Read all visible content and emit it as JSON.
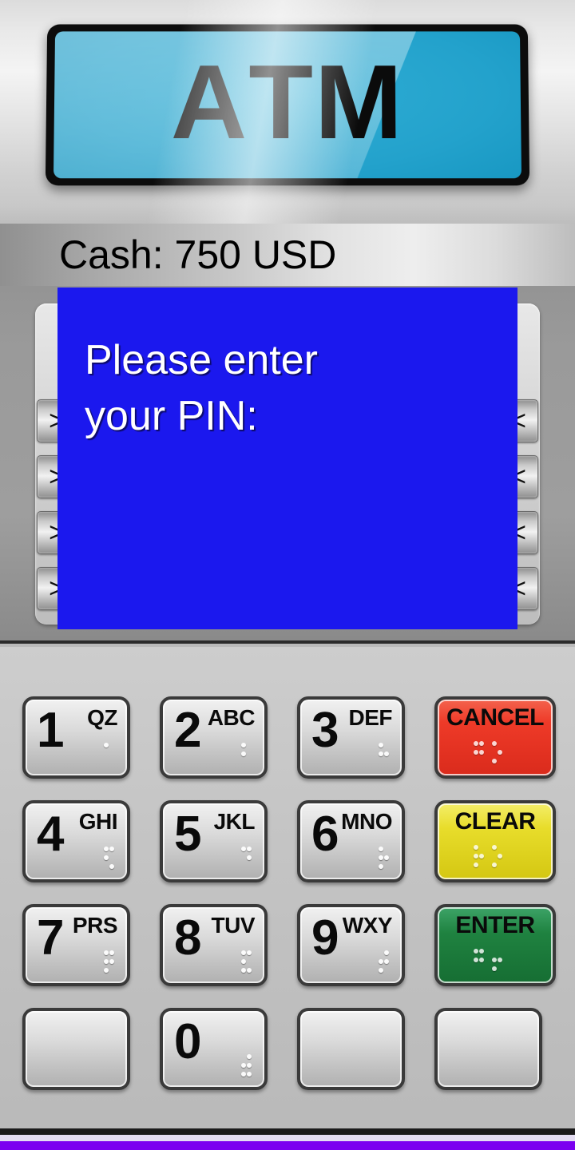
{
  "app": {
    "logo_text": "ATM",
    "logo_letter_dim": "A",
    "logo_letters_bright": "TM",
    "logo_color": "#23a2cc",
    "logo_text_color": "#0b0b0b"
  },
  "status": {
    "cash_label": "Cash: 750 USD",
    "cash_amount": "750",
    "cash_currency": "USD"
  },
  "screen": {
    "background_color": "#1b18ee",
    "text_color": "#ffffff",
    "line1": "Please enter",
    "line2": "your PIN:"
  },
  "softkeys": {
    "left_glyph": ">",
    "right_glyph": "<",
    "left": [
      {
        "name": "softkey-left-1",
        "glyph": ">"
      },
      {
        "name": "softkey-left-2",
        "glyph": ">"
      },
      {
        "name": "softkey-left-3",
        "glyph": ">"
      },
      {
        "name": "softkey-left-4",
        "glyph": ">"
      }
    ],
    "right": [
      {
        "name": "softkey-right-1",
        "glyph": "<"
      },
      {
        "name": "softkey-right-2",
        "glyph": "<"
      },
      {
        "name": "softkey-right-3",
        "glyph": "<"
      },
      {
        "name": "softkey-right-4",
        "glyph": "<"
      }
    ]
  },
  "keypad": {
    "keys": [
      {
        "digit": "1",
        "letters": "QZ",
        "kind": "digit",
        "braille": [
          [
            1,
            0,
            0,
            0,
            0,
            0
          ]
        ]
      },
      {
        "digit": "2",
        "letters": "ABC",
        "kind": "digit",
        "braille": [
          [
            1,
            1,
            0,
            0,
            0,
            0
          ]
        ]
      },
      {
        "digit": "3",
        "letters": "DEF",
        "kind": "digit",
        "braille": [
          [
            1,
            1,
            0,
            0,
            1,
            0
          ]
        ]
      },
      {
        "label": "CANCEL",
        "kind": "action",
        "color": "#ee3a28",
        "braille": [
          [
            1,
            1,
            0,
            1,
            1,
            0
          ],
          [
            1,
            0,
            1,
            0,
            1,
            0
          ]
        ]
      },
      {
        "digit": "4",
        "letters": "GHI",
        "kind": "digit",
        "braille": [
          [
            1,
            1,
            0,
            1,
            0,
            1
          ]
        ]
      },
      {
        "digit": "5",
        "letters": "JKL",
        "kind": "digit",
        "braille": [
          [
            1,
            0,
            0,
            1,
            1,
            0
          ]
        ]
      },
      {
        "digit": "6",
        "letters": "MNO",
        "kind": "digit",
        "braille": [
          [
            1,
            1,
            1,
            0,
            1,
            0
          ]
        ]
      },
      {
        "label": "CLEAR",
        "kind": "action",
        "color": "#e8dd2b",
        "braille": [
          [
            1,
            1,
            1,
            0,
            1,
            0
          ],
          [
            1,
            0,
            1,
            0,
            1,
            0
          ]
        ]
      },
      {
        "digit": "7",
        "letters": "PRS",
        "kind": "digit",
        "braille": [
          [
            1,
            1,
            1,
            1,
            1,
            0
          ]
        ]
      },
      {
        "digit": "8",
        "letters": "TUV",
        "kind": "digit",
        "braille": [
          [
            1,
            1,
            1,
            1,
            0,
            1
          ]
        ]
      },
      {
        "digit": "9",
        "letters": "WXY",
        "kind": "digit",
        "braille": [
          [
            0,
            1,
            1,
            1,
            1,
            0
          ]
        ]
      },
      {
        "label": "ENTER",
        "kind": "action",
        "color": "#1f8240",
        "braille": [
          [
            1,
            1,
            0,
            1,
            1,
            0
          ],
          [
            0,
            1,
            1,
            0,
            1,
            0
          ]
        ]
      },
      {
        "kind": "blank"
      },
      {
        "digit": "0",
        "letters": "",
        "kind": "digit",
        "braille": [
          [
            0,
            1,
            1,
            1,
            1,
            1
          ]
        ]
      },
      {
        "kind": "blank"
      },
      {
        "kind": "blank"
      }
    ]
  },
  "bottom_bar": {
    "accent_color": "#7b00f0",
    "dark_color": "#1b1b1b",
    "light_color": "#e4ddf2"
  }
}
